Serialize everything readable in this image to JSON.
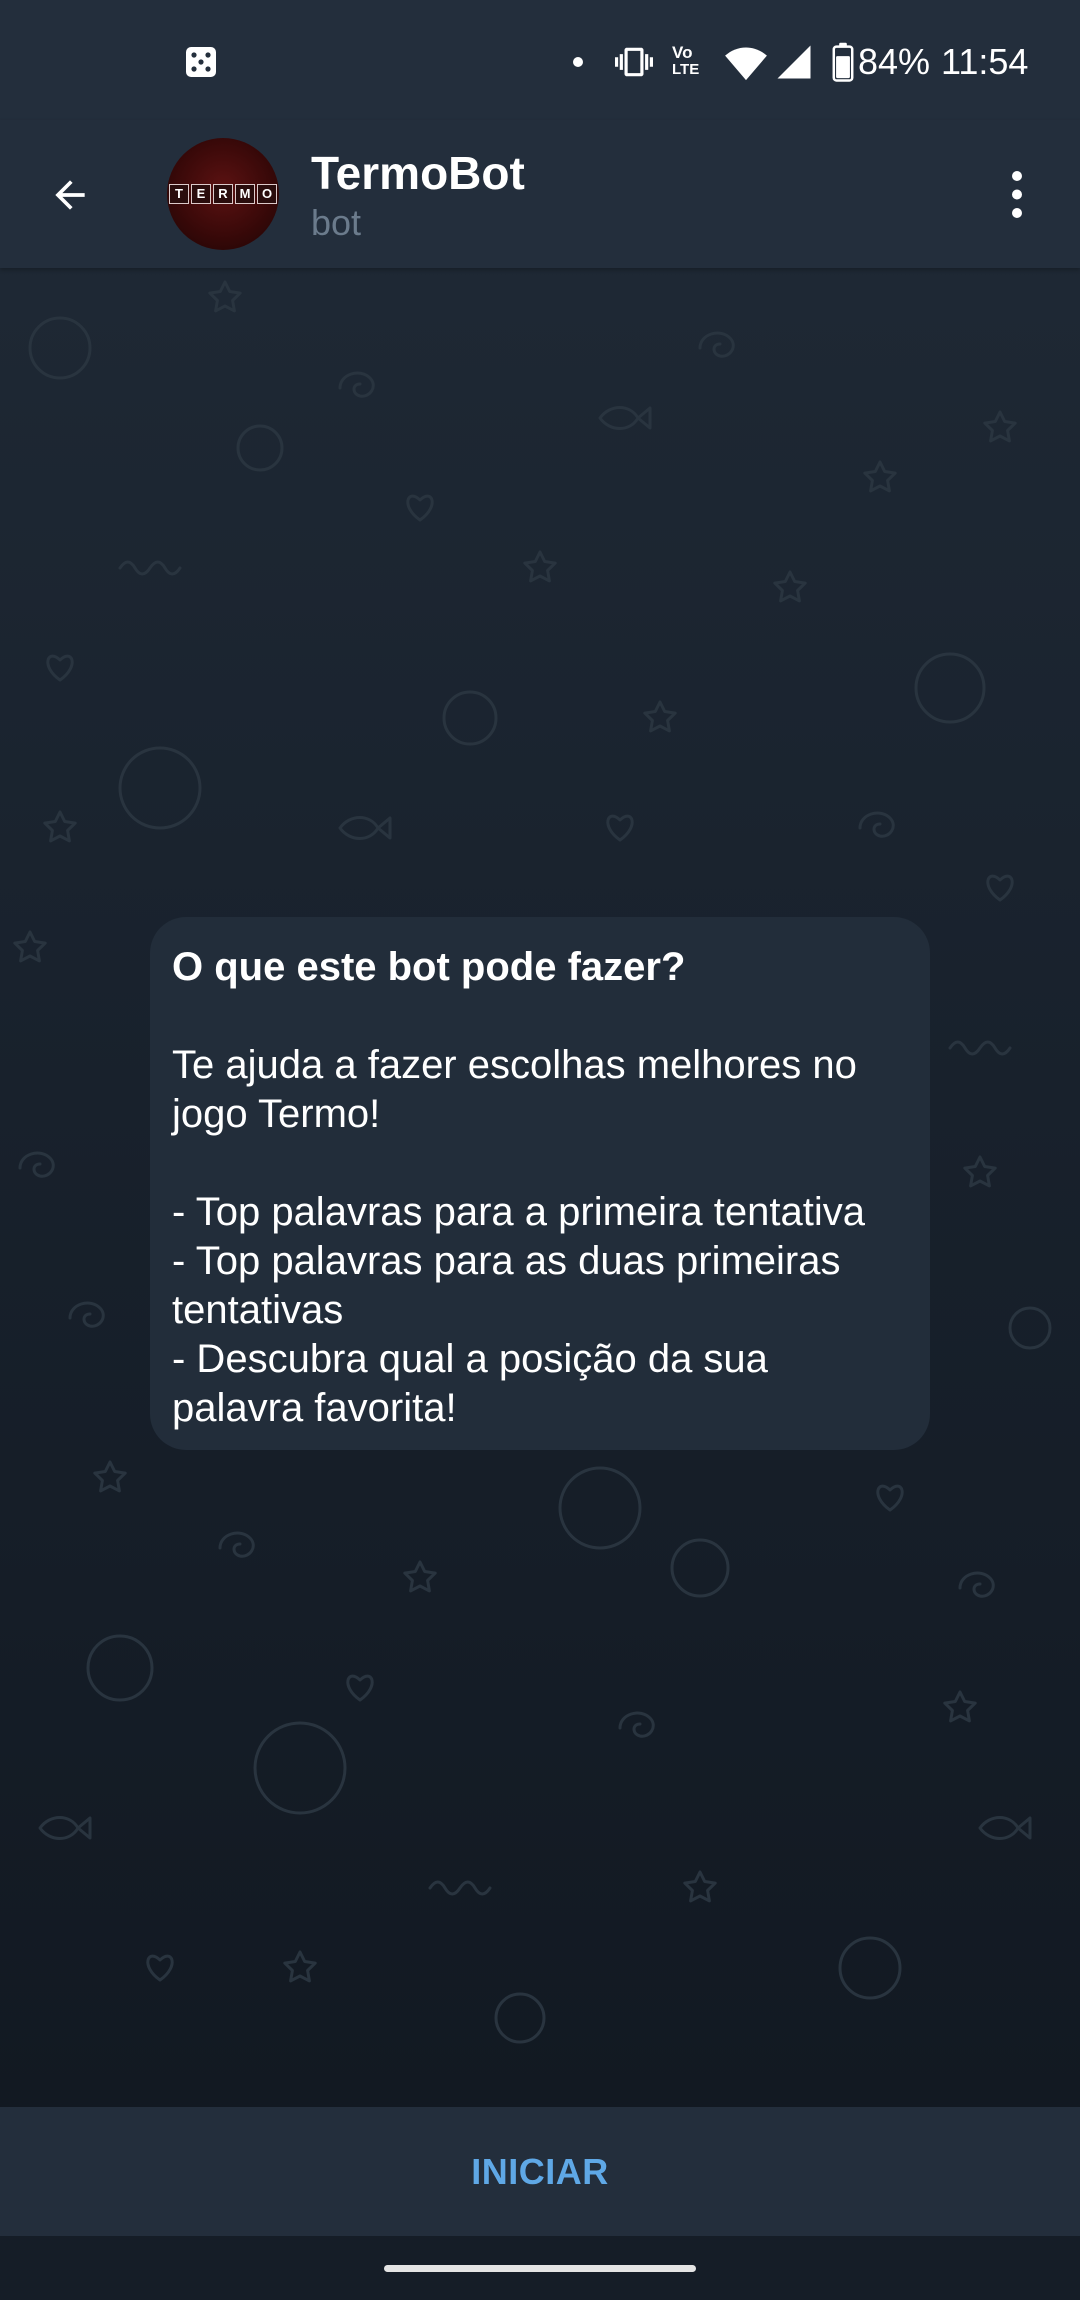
{
  "status_bar": {
    "time": "11:54",
    "battery_text": "84%",
    "battery_level": 0.84,
    "volte": {
      "top": "Vo",
      "bottom": "LTE"
    },
    "icons": [
      "notification-icon",
      "notification-dot-icon",
      "vibrate-icon",
      "volte-icon",
      "wifi-icon",
      "cellular-signal-icon",
      "battery-icon"
    ]
  },
  "header": {
    "title": "TermoBot",
    "subtitle": "bot",
    "avatar_letters": [
      "T",
      "E",
      "R",
      "M",
      "O"
    ],
    "back_icon": "back-arrow-icon",
    "menu_icon": "more-vert-icon"
  },
  "message": {
    "title": "O que este bot pode fazer?",
    "paragraphs": [
      [
        "Te ajuda a fazer escolhas melhores no",
        "jogo Termo!"
      ],
      [
        "- Top palavras para a primeira tentativa",
        "- Top palavras para as duas primeiras",
        "tentativas",
        "- Descubra qual a posição da sua",
        "palavra favorita!"
      ]
    ]
  },
  "bottom_bar": {
    "start_label": "INICIAR"
  },
  "colors": {
    "accent": "#5fa8e6",
    "bar_background": "#232e3c",
    "bubble_background": "#222d3a",
    "subtitle": "#6b7b8c",
    "nav_background": "#151d27"
  }
}
